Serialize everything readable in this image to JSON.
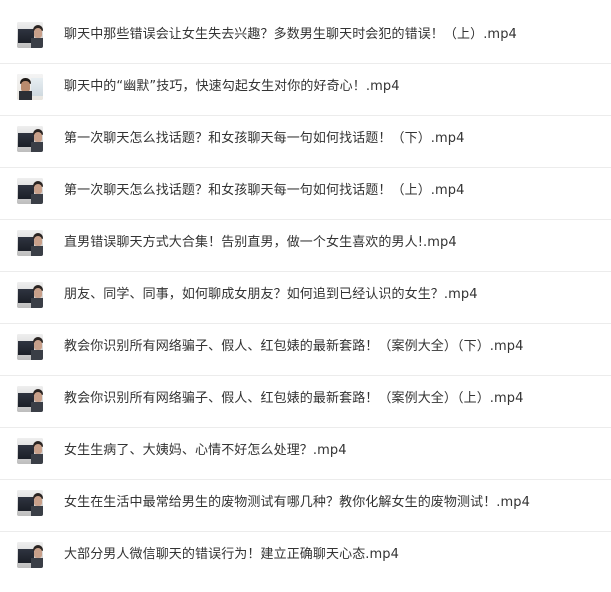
{
  "files": [
    {
      "name": "聊天中那些错误会让女生失去兴趣？多数男生聊天时会犯的错误！（上）.mp4",
      "thumb": "video-thumbnail"
    },
    {
      "name": "聊天中的“幽默”技巧，快速勾起女生对你的好奇心！.mp4",
      "thumb": "video-thumbnail-alt"
    },
    {
      "name": "第一次聊天怎么找话题？和女孩聊天每一句如何找话题！（下）.mp4",
      "thumb": "video-thumbnail"
    },
    {
      "name": "第一次聊天怎么找话题？和女孩聊天每一句如何找话题！（上）.mp4",
      "thumb": "video-thumbnail"
    },
    {
      "name": "直男错误聊天方式大合集！告别直男，做一个女生喜欢的男人!.mp4",
      "thumb": "video-thumbnail"
    },
    {
      "name": "朋友、同学、同事，如何聊成女朋友？如何追到已经认识的女生？.mp4",
      "thumb": "video-thumbnail"
    },
    {
      "name": "教会你识别所有网络骗子、假人、红包婊的最新套路！（案例大全）（下）.mp4",
      "thumb": "video-thumbnail"
    },
    {
      "name": "教会你识别所有网络骗子、假人、红包婊的最新套路！（案例大全）（上）.mp4",
      "thumb": "video-thumbnail"
    },
    {
      "name": "女生生病了、大姨妈、心情不好怎么处理？.mp4",
      "thumb": "video-thumbnail"
    },
    {
      "name": "女生在生活中最常给男生的废物测试有哪几种？教你化解女生的废物测试！.mp4",
      "thumb": "video-thumbnail"
    },
    {
      "name": "大部分男人微信聊天的错误行为！建立正确聊天心态.mp4",
      "thumb": "video-thumbnail"
    }
  ]
}
